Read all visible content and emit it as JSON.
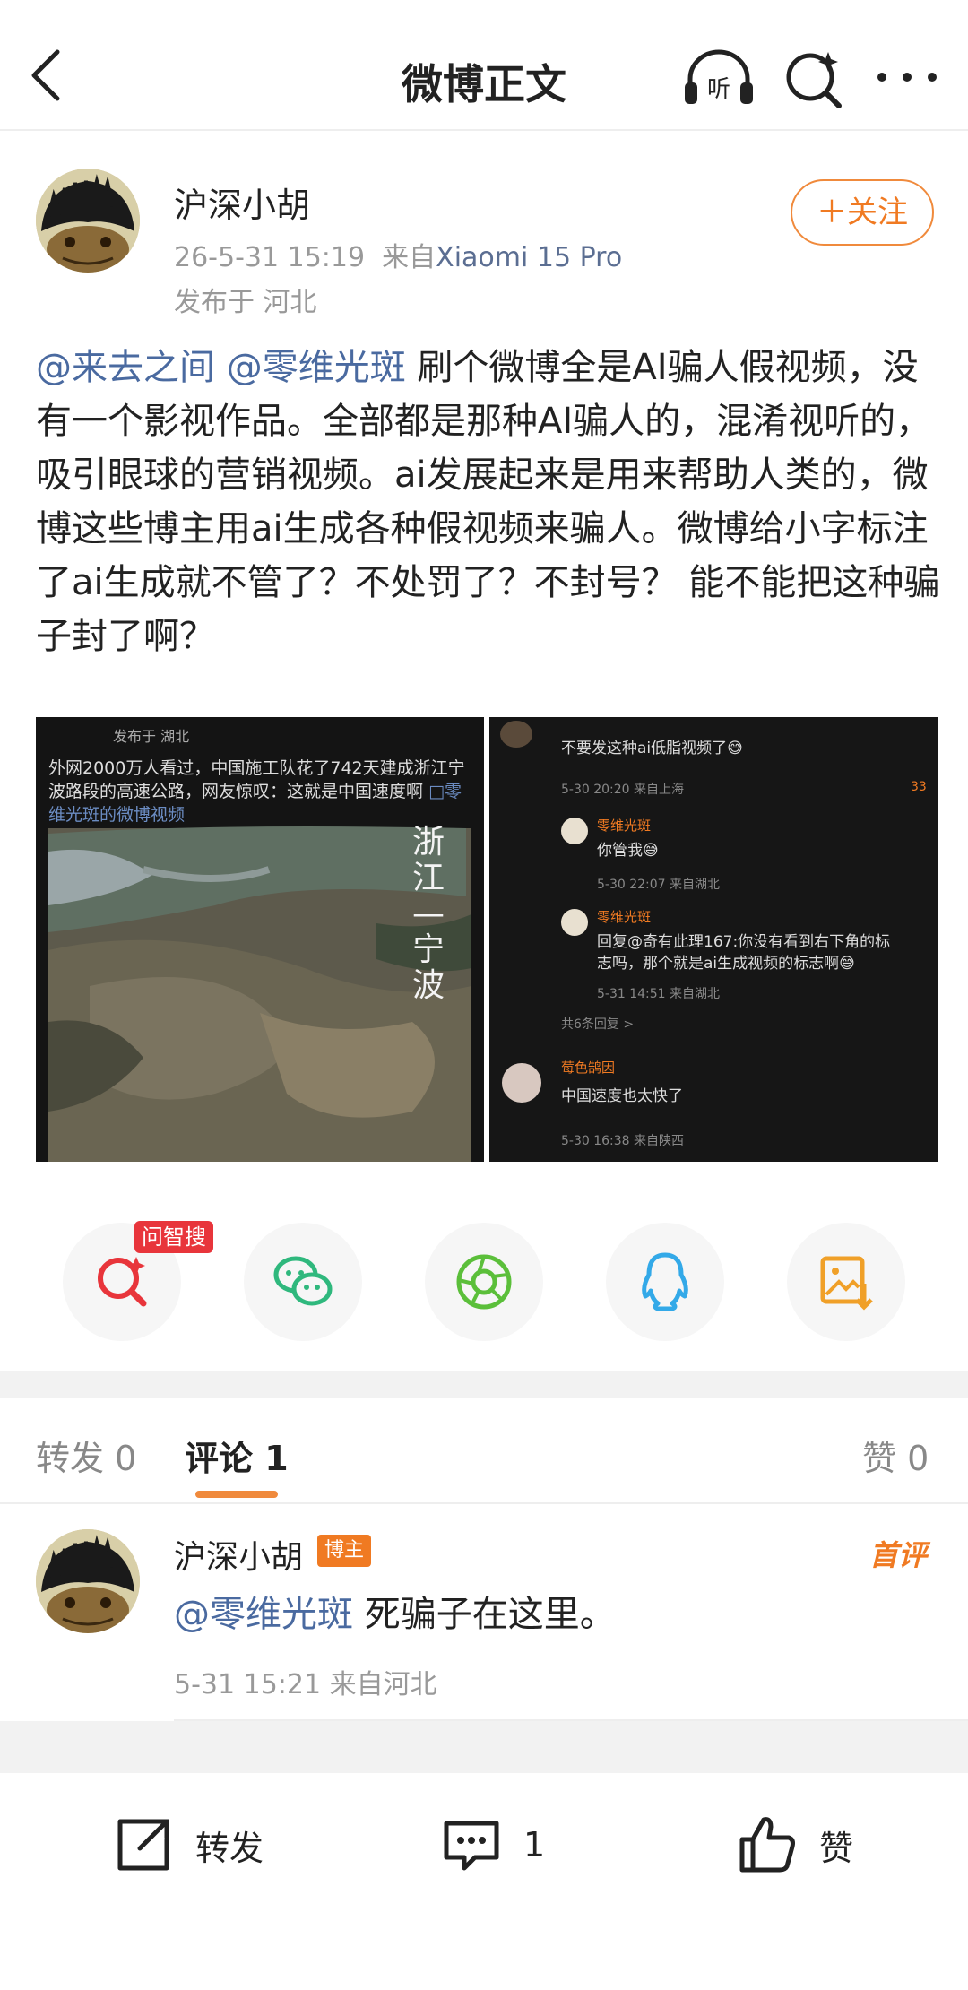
{
  "header": {
    "title": "微博正文",
    "back_icon": "back-arrow-icon",
    "listen_label": "听"
  },
  "post": {
    "author": "沪深小胡",
    "time": "26-5-31 15:19",
    "source_prefix": "来自",
    "device": "Xiaomi 15 Pro",
    "location": "发布于 河北",
    "follow_label": "＋关注",
    "mention1": "@来去之间",
    "mention2": "@零维光斑",
    "text": " 刷个微博全是AI骗人假视频，没有一个影视作品。全部都是那种AI骗人的，混淆视听的，吸引眼球的营销视频。ai发展起来是用来帮助人类的，微博这些博主用ai生成各种假视频来骗人。微博给小字标注了ai生成就不管了？不处罚了？不封号？ 能不能把这种骗子封了啊？"
  },
  "images": {
    "left": {
      "published": "发布于 湖北",
      "caption_line1": "外网2000万人看过，中国施工队花了742天建成浙江宁",
      "caption_line2": "波路段的高速公路，网友惊叹：这就是中国速度啊",
      "caption_link": "□零",
      "caption_line3": "维光斑的微博视频",
      "overlay": "浙江—宁波"
    },
    "right": {
      "c1_text": "不要发这种ai低脂视频了😅",
      "c1_meta": "5-30 20:20 来自上海",
      "c1_likes": "33",
      "c2_name": "零维光斑",
      "c2_text": "你管我😅",
      "c2_meta": "5-30 22:07 来自湖北",
      "c3_name": "零维光斑",
      "c3_text1": "回复@奇有此理167:你没有看到右下角的标",
      "c3_text2": "志吗，那个就是ai生成视频的标志啊😅",
      "c3_meta": "5-31 14:51 来自湖北",
      "c3_replies": "共6条回复 >",
      "c4_name": "莓色鹄因",
      "c4_text": "中国速度也太快了",
      "c4_meta": "5-30 16:38 来自陕西"
    }
  },
  "share": {
    "badge": "问智搜",
    "items": [
      "search-ai-icon",
      "wechat-icon",
      "moments-icon",
      "qq-icon",
      "save-image-icon"
    ],
    "colors": {
      "search": "#e8353b",
      "wechat": "#2fb87d",
      "moments": "#5bbf3a",
      "qq": "#33a9e8",
      "save": "#f0a028"
    }
  },
  "tabs": {
    "repost_label": "转发",
    "repost_count": "0",
    "comment_label": "评论",
    "comment_count": "1",
    "like_label": "赞",
    "like_count": "0"
  },
  "comment": {
    "author": "沪深小胡",
    "badge": "博主",
    "first": "首评",
    "mention": "@零维光斑",
    "text": " 死骗子在这里。",
    "meta": "5-31 15:21 来自河北"
  },
  "bottom": {
    "repost": "转发",
    "comment": "1",
    "like": "赞"
  },
  "accent": "#f07a22",
  "link_color": "#4a6aa0"
}
